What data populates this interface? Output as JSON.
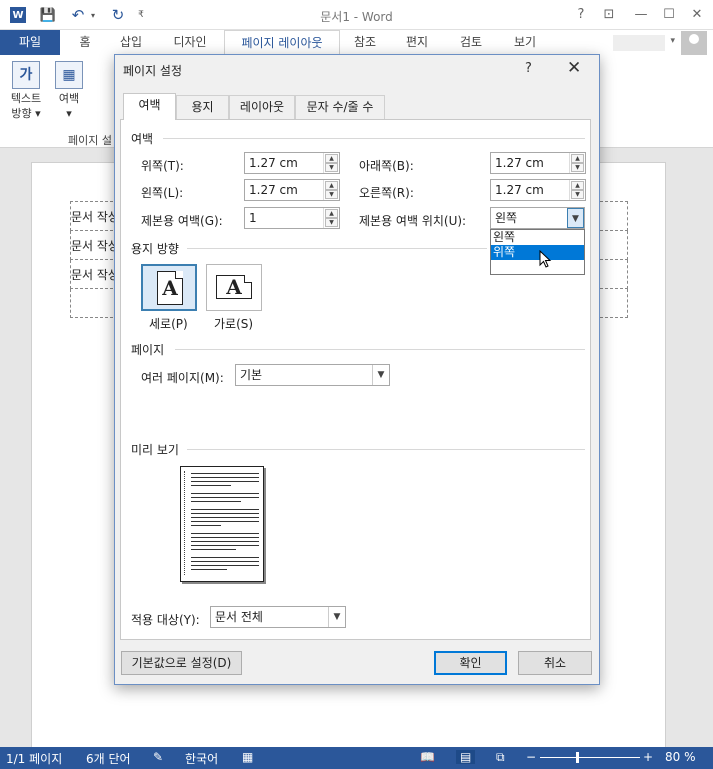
{
  "window": {
    "title": "문서1 - Word",
    "help": "?",
    "ribbon_display": "⊡",
    "minimize": "—",
    "maximize": "☐",
    "close": "✕"
  },
  "quick_access": {
    "app_icon": "W",
    "save_icon": "floppy-icon",
    "undo_icon": "undo-icon",
    "redo_icon": "redo-icon",
    "undo_glyph": "↶",
    "undo_dd": "▾",
    "redo_glyph": "↻",
    "customize_glyph": "₹"
  },
  "ribbon_tabs": [
    {
      "label": "파일"
    },
    {
      "label": "홈"
    },
    {
      "label": "삽입"
    },
    {
      "label": "디자인"
    },
    {
      "label": "페이지 레이아웃"
    },
    {
      "label": "참조"
    },
    {
      "label": "편지"
    },
    {
      "label": "검토"
    },
    {
      "label": "보기"
    }
  ],
  "ribbon": {
    "text_direction_label": "텍스트",
    "text_direction_label2": "방향 ▾",
    "text_direction_glyph": "가",
    "margins_label": "여백",
    "margins_label2": "▾",
    "margins_glyph": "▦",
    "group_label": "페이지 설"
  },
  "document": {
    "rows": [
      "문서 작성",
      "문서 작성",
      "문서 작성",
      ""
    ]
  },
  "statusbar": {
    "page": "1/1 페이지",
    "words": "6개 단어",
    "language": "한국어",
    "zoom": "80 %",
    "zoom_minus": "−",
    "zoom_plus": "+"
  },
  "dialog": {
    "title": "페이지 설정",
    "help": "?",
    "close": "✕",
    "tabs": [
      "여백",
      "용지",
      "레이아웃",
      "문자 수/줄 수"
    ],
    "margins_section": "여백",
    "top_label": "위쪽(T):",
    "top_value": "1.27 cm",
    "bottom_label": "아래쪽(B):",
    "bottom_value": "1.27 cm",
    "left_label": "왼쪽(L):",
    "left_value": "1.27 cm",
    "right_label": "오른쪽(R):",
    "right_value": "1.27 cm",
    "gutter_label": "제본용 여백(G):",
    "gutter_value": "1",
    "gutter_pos_label": "제본용 여백 위치(U):",
    "gutter_pos_value": "왼쪽",
    "gutter_pos_options": [
      "왼쪽",
      "위쪽"
    ],
    "gutter_pos_highlighted": "위쪽",
    "orientation_section": "용지 방향",
    "portrait_label": "세로(P)",
    "landscape_label": "가로(S)",
    "portrait_glyph": "A",
    "landscape_glyph": "A",
    "pages_section": "페이지",
    "multiple_pages_label": "여러 페이지(M):",
    "multiple_pages_value": "기본",
    "preview_section": "미리 보기",
    "apply_to_label": "적용 대상(Y):",
    "apply_to_value": "문서 전체",
    "default_button": "기본값으로 설정(D)",
    "ok_button": "확인",
    "cancel_button": "취소"
  }
}
